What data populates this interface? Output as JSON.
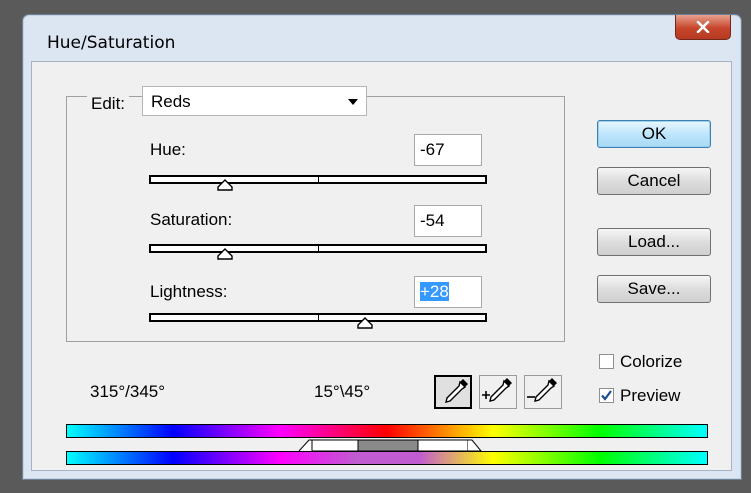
{
  "window": {
    "title": "Hue/Saturation",
    "close_glyph": "x"
  },
  "edit": {
    "label": "Edit:",
    "value": "Reds"
  },
  "sliders": {
    "hue": {
      "label": "Hue:",
      "value": "-67"
    },
    "saturation": {
      "label": "Saturation:",
      "value": "-54"
    },
    "lightness": {
      "label": "Lightness:",
      "value": "+28"
    }
  },
  "buttons": {
    "ok": "OK",
    "cancel": "Cancel",
    "load": "Load...",
    "save": "Save..."
  },
  "checkboxes": {
    "colorize": {
      "label": "Colorize",
      "checked": false
    },
    "preview": {
      "label": "Preview",
      "checked": true
    }
  },
  "range": {
    "left": "315°/345°",
    "right": "15°\\45°"
  },
  "tools": [
    {
      "name": "eyedropper-icon",
      "pressed": true
    },
    {
      "name": "eyedropper-plus-icon",
      "pressed": false
    },
    {
      "name": "eyedropper-minus-icon",
      "pressed": false
    }
  ],
  "colors": {
    "accent": "#3399ff",
    "title_bg": "#dce6f2",
    "close": "#c7452c"
  }
}
